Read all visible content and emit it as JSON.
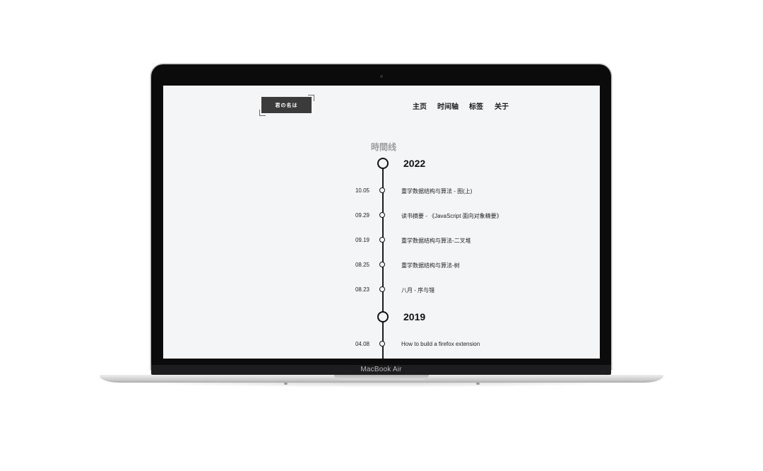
{
  "device": {
    "label": "MacBook Air"
  },
  "site": {
    "logo": "君の名は",
    "nav": [
      "主页",
      "时间轴",
      "标签",
      "关于"
    ],
    "page_title": "時間线",
    "years": [
      {
        "year": "2022",
        "posts": [
          {
            "date": "10.05",
            "title": "重学数据结构与算法 - 图(上)"
          },
          {
            "date": "09.29",
            "title": "读书摘要 - 《JavaScript 面向对象精要》"
          },
          {
            "date": "09.19",
            "title": "重学数据结构与算法-二叉堆"
          },
          {
            "date": "08.25",
            "title": "重学数据结构与算法-树"
          },
          {
            "date": "08.23",
            "title": "八月 - 序与错"
          }
        ]
      },
      {
        "year": "2019",
        "posts": [
          {
            "date": "04.08",
            "title": "How to build a firefox extension"
          }
        ]
      }
    ]
  },
  "colors": {
    "screen_bg": "#f4f5f7",
    "logo_bg": "#3b3b3b",
    "accent": "#111111",
    "title_muted": "#9e9e9e"
  }
}
